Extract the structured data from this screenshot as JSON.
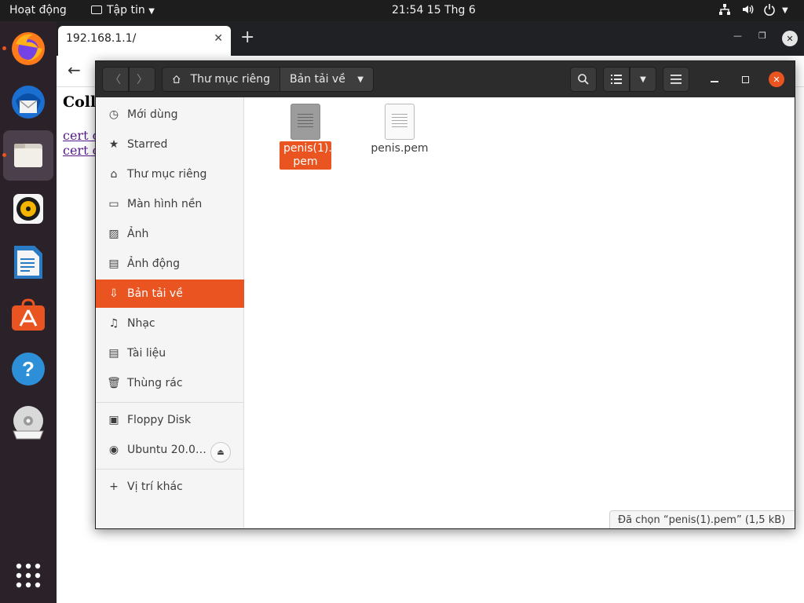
{
  "topbar": {
    "activities": "Hoạt động",
    "app_menu": "Tập tin",
    "clock": "21:54  15 Thg 6"
  },
  "dock": {
    "items": [
      "firefox-icon",
      "thunderbird-icon",
      "files-icon",
      "rhythmbox-icon",
      "libreoffice-writer-icon",
      "software-center-icon",
      "help-icon",
      "dvd-icon"
    ],
    "show_apps": "show-applications-icon"
  },
  "browser": {
    "tab_title": "192.168.1.1/",
    "content_heading": "Coll",
    "links": [
      "cert c",
      "cert c"
    ]
  },
  "files": {
    "breadcrumb_home": "Thư mục riêng",
    "breadcrumb_current": "Bản tải về",
    "sidebar": [
      {
        "label": "Mới dùng",
        "icon": "clock-icon"
      },
      {
        "label": "Starred",
        "icon": "star-icon"
      },
      {
        "label": "Thư mục riêng",
        "icon": "home-icon"
      },
      {
        "label": "Màn hình nền",
        "icon": "desktop-icon"
      },
      {
        "label": "Ảnh",
        "icon": "image-icon"
      },
      {
        "label": "Ảnh động",
        "icon": "film-icon"
      },
      {
        "label": "Bản tải về",
        "icon": "download-icon"
      },
      {
        "label": "Nhạc",
        "icon": "music-icon"
      },
      {
        "label": "Tài liệu",
        "icon": "document-icon"
      },
      {
        "label": "Thùng rác",
        "icon": "trash-icon"
      },
      {
        "label": "Floppy Disk",
        "icon": "floppy-icon"
      },
      {
        "label": "Ubuntu 20.0…",
        "icon": "disc-icon"
      },
      {
        "label": "Vị trí khác",
        "icon": "plus-icon"
      }
    ],
    "selected_sidebar": "Bản tải về",
    "items": [
      {
        "name_line1": "penis(1).",
        "name_line2": "pem",
        "selected": true
      },
      {
        "name": "penis.pem",
        "selected": false
      }
    ],
    "status": "Đã chọn “penis(1).pem”  (1,5 kB)",
    "accent_color": "#e95420"
  }
}
